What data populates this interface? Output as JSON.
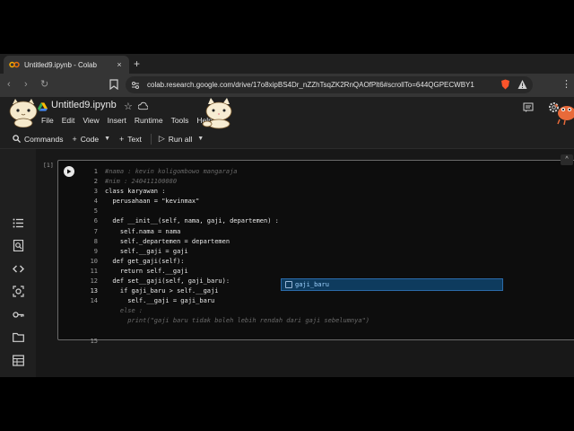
{
  "browser": {
    "tab_title": "Untitled9.ipynb - Colab",
    "tab_close": "×",
    "new_tab": "+",
    "url": "colab.research.google.com/drive/17o8xipBS4Dr_nZZhTsqZK2RnQAOfPlt6#scrollTo=644QGPECWBY1",
    "back": "‹",
    "forward": "›",
    "reload": "↻",
    "menu": "⋮"
  },
  "colab": {
    "title": "Untitled9.ipynb",
    "star": "☆",
    "menus": [
      "File",
      "Edit",
      "View",
      "Insert",
      "Runtime",
      "Tools",
      "Help"
    ],
    "commands": {
      "label": "Commands",
      "icon": "🔍︎"
    },
    "code": {
      "label": "Code",
      "icon": "+"
    },
    "text": {
      "label": "Text",
      "icon": "+"
    },
    "run_all": {
      "label": "Run all",
      "icon": "▷"
    }
  },
  "cell": {
    "exec_label": "[1]",
    "scroll_up": "^",
    "lines": [
      {
        "n": "1",
        "segs": [
          {
            "t": "#nama : kevin koligombowo mangaraja",
            "c": "cm"
          }
        ]
      },
      {
        "n": "2",
        "segs": [
          {
            "t": "#nim : 240411100080",
            "c": "cm"
          }
        ]
      },
      {
        "n": "3",
        "segs": [
          {
            "t": "class karyawan :",
            "c": "tx"
          }
        ]
      },
      {
        "n": "4",
        "segs": [
          {
            "t": "  perusahaan = \"kevinmax\"",
            "c": "tx"
          }
        ]
      },
      {
        "n": "5",
        "segs": [
          {
            "t": "",
            "c": "tx"
          }
        ]
      },
      {
        "n": "6",
        "segs": [
          {
            "t": "  def __init__(self, nama, gaji, departemen) :",
            "c": "tx"
          }
        ]
      },
      {
        "n": "7",
        "segs": [
          {
            "t": "    self.nama = nama",
            "c": "tx"
          }
        ]
      },
      {
        "n": "8",
        "segs": [
          {
            "t": "    self._departemen = departemen",
            "c": "tx"
          }
        ]
      },
      {
        "n": "9",
        "segs": [
          {
            "t": "    self.__gaji = gaji",
            "c": "tx"
          }
        ]
      },
      {
        "n": "10",
        "segs": [
          {
            "t": "  def get_gaji(self):",
            "c": "tx"
          }
        ]
      },
      {
        "n": "11",
        "segs": [
          {
            "t": "    return self.__gaji",
            "c": "tx"
          }
        ]
      },
      {
        "n": "12",
        "segs": [
          {
            "t": "  def set__gaji(self, gaji_baru):",
            "c": "tx"
          }
        ]
      },
      {
        "n": "13",
        "segs": [
          {
            "t": "    if gaji_baru > self.__gaji",
            "c": "tx"
          }
        ]
      },
      {
        "n": "14",
        "segs": [
          {
            "t": "      self.__gaji = gaji_baru",
            "c": "tx"
          }
        ]
      },
      {
        "n": "",
        "segs": [
          {
            "t": "    else :",
            "c": "cm"
          }
        ]
      },
      {
        "n": "",
        "segs": [
          {
            "t": "      print(\"gaji baru tidak boleh lebih rendah dari gaji sebelumnya\")",
            "c": "cm"
          }
        ]
      },
      {
        "n": "",
        "segs": [
          {
            "t": "",
            "c": "tx"
          }
        ]
      },
      {
        "n": "15",
        "segs": [
          {
            "t": "",
            "c": "tx"
          }
        ]
      }
    ],
    "autocomplete": "gaji_baru"
  },
  "colors": {
    "accent_blue": "#2b6aa8",
    "background": "#1f1f1f",
    "cell_bg": "#0d0d0d"
  }
}
